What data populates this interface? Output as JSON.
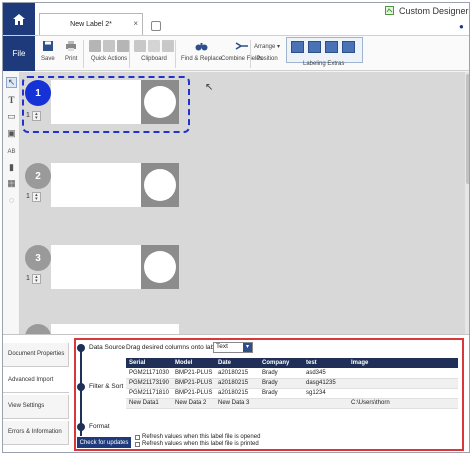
{
  "title_bar": {
    "tab_label": "New Label 2*",
    "tab_close": "×",
    "app_title": "Custom Designer"
  },
  "ribbon": {
    "file": "File",
    "save": "Save",
    "print": "Print",
    "quick_actions": "Quick Actions",
    "clipboard": "Clipboard",
    "find_replace": "Find & Replace",
    "combine_fields": "Combine Fields",
    "arrange": "Arrange ▾",
    "position": "Position",
    "labeling_extras": "Labeling Extras"
  },
  "labels": [
    {
      "number": "1",
      "quantity": "1",
      "selected": true
    },
    {
      "number": "2",
      "quantity": "1",
      "selected": false
    },
    {
      "number": "3",
      "quantity": "1",
      "selected": false
    }
  ],
  "bottom_panel": {
    "tabs": [
      "Document Properties",
      "Advanced Import",
      "View Settings",
      "Errors & Information"
    ],
    "active_tab": "Advanced Import",
    "steps": [
      "Data Source",
      "Filter & Sort",
      "Format"
    ],
    "drag_text": "Drag desired columns onto label:",
    "dropdown_value": "Text",
    "table": {
      "columns": [
        "Serial",
        "Model",
        "Date",
        "Company",
        "test",
        "Image"
      ],
      "rows": [
        [
          "PGM21171030",
          "BMP21-PLUS",
          "a20180215",
          "Brady",
          "asd345",
          ""
        ],
        [
          "PGM21173190",
          "BMP21-PLUS",
          "a20180215",
          "Brady",
          "dasg41235",
          ""
        ],
        [
          "PGM21171810",
          "BMP21-PLUS",
          "a20180215",
          "Brady",
          "sg1234",
          ""
        ],
        [
          "New Data1",
          "New Data 2",
          "New Data 3",
          "",
          "",
          "C:\\Users\\thorn"
        ]
      ]
    },
    "check_updates": "Check for updates",
    "refresh_opened": "Refresh values when this label file is opened",
    "refresh_printed": "Refresh values when this label file is printed"
  },
  "colors": {
    "navy": "#1f3a7a",
    "dark_navy": "#1f2f57",
    "selected_number": "#1432d6",
    "unselected_number": "#9a9a9a",
    "highlight_red": "#d9383a"
  }
}
